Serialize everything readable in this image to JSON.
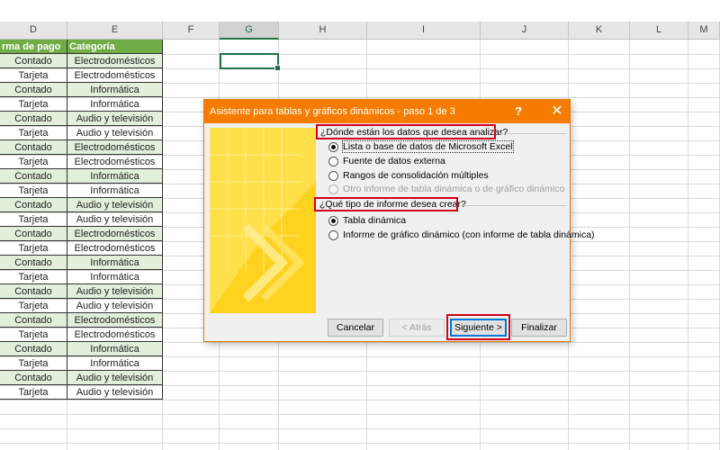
{
  "spreadsheet": {
    "columns": [
      "D",
      "E",
      "F",
      "G",
      "H",
      "I",
      "J",
      "K",
      "L",
      "M"
    ],
    "selected_column": "G",
    "headers": [
      "rma de pago",
      "Categoría"
    ],
    "rows": [
      [
        "Contado",
        "Electrodomésticos"
      ],
      [
        "Tarjeta",
        "Electrodomésticos"
      ],
      [
        "Contado",
        "Informática"
      ],
      [
        "Tarjeta",
        "Informática"
      ],
      [
        "Contado",
        "Audio y televisión"
      ],
      [
        "Tarjeta",
        "Audio y televisión"
      ],
      [
        "Contado",
        "Electrodomésticos"
      ],
      [
        "Tarjeta",
        "Electrodomésticos"
      ],
      [
        "Contado",
        "Informática"
      ],
      [
        "Tarjeta",
        "Informática"
      ],
      [
        "Contado",
        "Audio y televisión"
      ],
      [
        "Tarjeta",
        "Audio y televisión"
      ],
      [
        "Contado",
        "Electrodomésticos"
      ],
      [
        "Tarjeta",
        "Electrodomésticos"
      ],
      [
        "Contado",
        "Informática"
      ],
      [
        "Tarjeta",
        "Informática"
      ],
      [
        "Contado",
        "Audio y televisión"
      ],
      [
        "Tarjeta",
        "Audio y televisión"
      ],
      [
        "Contado",
        "Electrodomésticos"
      ],
      [
        "Tarjeta",
        "Electrodomésticos"
      ],
      [
        "Contado",
        "Informática"
      ],
      [
        "Tarjeta",
        "Informática"
      ],
      [
        "Contado",
        "Audio y televisión"
      ],
      [
        "Tarjeta",
        "Audio y televisión"
      ]
    ]
  },
  "dialog": {
    "title": "Asistente para tablas y gráficos dinámicos - paso 1 de 3",
    "help_glyph": "?",
    "close_glyph": "✕",
    "question1": "¿Dónde están los datos que desea analizar?",
    "source_options": [
      "Lista o base de datos de Microsoft Excel",
      "Fuente de datos externa",
      "Rangos de consolidación múltiples",
      "Otro informe de tabla dinámica o de gráfico dinámico"
    ],
    "selected_source": 0,
    "question2": "¿Qué tipo de informe desea crear?",
    "report_options": [
      "Tabla dinámica",
      "Informe de gráfico dinámico (con informe de tabla dinámica)"
    ],
    "selected_report": 0,
    "buttons": {
      "cancel": "Cancelar",
      "back": "< Atrás",
      "next": "Siguiente >",
      "finish": "Finalizar"
    }
  },
  "colors": {
    "title_bar": "#f57c00",
    "table_header": "#70ad47",
    "band_row": "#e2efda",
    "highlight": "#d0021b",
    "excel_green": "#217346"
  }
}
